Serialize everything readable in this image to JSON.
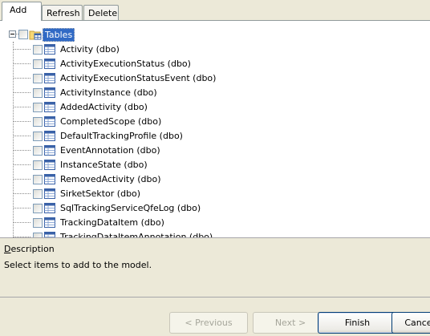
{
  "tabs": [
    {
      "label": "Add",
      "active": true
    },
    {
      "label": "Refresh",
      "active": false
    },
    {
      "label": "Delete",
      "active": false
    }
  ],
  "tree": {
    "root_label": "Tables",
    "items": [
      {
        "label": "Activity (dbo)"
      },
      {
        "label": "ActivityExecutionStatus (dbo)"
      },
      {
        "label": "ActivityExecutionStatusEvent (dbo)"
      },
      {
        "label": "ActivityInstance (dbo)"
      },
      {
        "label": "AddedActivity (dbo)"
      },
      {
        "label": "CompletedScope (dbo)"
      },
      {
        "label": "DefaultTrackingProfile (dbo)"
      },
      {
        "label": "EventAnnotation (dbo)"
      },
      {
        "label": "InstanceState (dbo)"
      },
      {
        "label": "RemovedActivity (dbo)"
      },
      {
        "label": "SirketSektor (dbo)"
      },
      {
        "label": "SqlTrackingServiceQfeLog (dbo)"
      },
      {
        "label": "TrackingDataItem (dbo)"
      },
      {
        "label": "TrackingDataItemAnnotation (dbo)"
      }
    ]
  },
  "description": {
    "title_prefix": "D",
    "title_rest": "escription",
    "text": "Select items to add to the model."
  },
  "buttons": {
    "previous": "< Previous",
    "next": "Next >",
    "finish": "Finish",
    "cancel": "Cancel"
  },
  "colors": {
    "selection": "#316ac5",
    "background": "#ece9d8"
  }
}
